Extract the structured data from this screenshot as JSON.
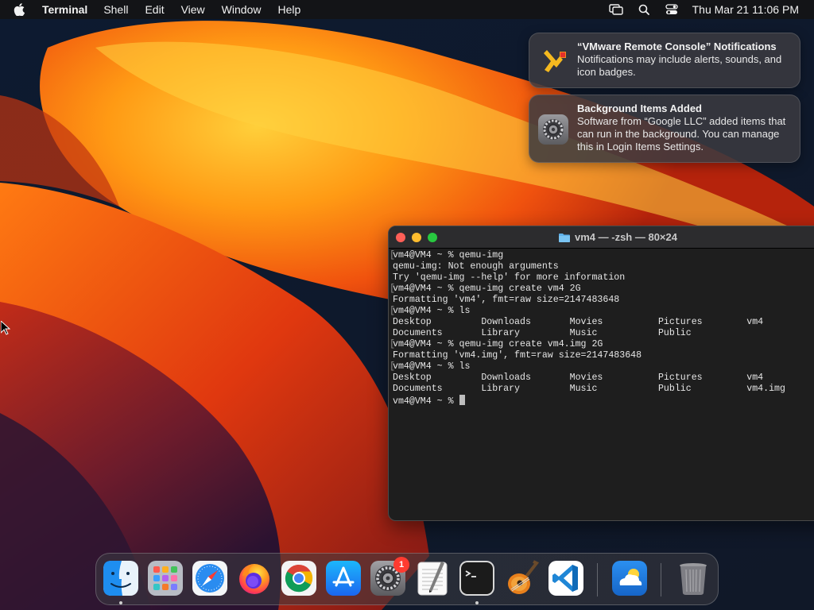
{
  "menubar": {
    "app_name": "Terminal",
    "menus": [
      "Shell",
      "Edit",
      "View",
      "Window",
      "Help"
    ],
    "clock": "Thu Mar 21  11:06 PM"
  },
  "notifications": [
    {
      "title": "“VMware Remote Console” Notifications",
      "body": "Notifications may include alerts, sounds, and icon badges.",
      "icon": "vmware-remote-console-icon"
    },
    {
      "title": "Background Items Added",
      "body": "Software from “Google LLC” added items that can run in the background. You can manage this in Login Items Settings.",
      "icon": "system-settings-gear-icon"
    }
  ],
  "terminal": {
    "title": "vm4 — -zsh — 80×24",
    "lines": [
      {
        "text": "vm4@VM4 ~ % qemu-img",
        "mark": true
      },
      {
        "text": "qemu-img: Not enough arguments",
        "mark": false
      },
      {
        "text": "Try 'qemu-img --help' for more information",
        "mark": false
      },
      {
        "text": "vm4@VM4 ~ % qemu-img create vm4 2G",
        "mark": true
      },
      {
        "text": "Formatting 'vm4', fmt=raw size=2147483648",
        "mark": false
      },
      {
        "text": "vm4@VM4 ~ % ls",
        "mark": true
      },
      {
        "text": "Desktop         Downloads       Movies          Pictures        vm4",
        "mark": false
      },
      {
        "text": "Documents       Library         Music           Public",
        "mark": false
      },
      {
        "text": "vm4@VM4 ~ % qemu-img create vm4.img 2G",
        "mark": true
      },
      {
        "text": "Formatting 'vm4.img', fmt=raw size=2147483648",
        "mark": false
      },
      {
        "text": "vm4@VM4 ~ % ls",
        "mark": true
      },
      {
        "text": "Desktop         Downloads       Movies          Pictures        vm4",
        "mark": false
      },
      {
        "text": "Documents       Library         Music           Public          vm4.img",
        "mark": false
      }
    ],
    "prompt": "vm4@VM4 ~ % "
  },
  "dock": {
    "items": [
      {
        "name": "finder",
        "running": true
      },
      {
        "name": "launchpad",
        "running": false
      },
      {
        "name": "safari",
        "running": false
      },
      {
        "name": "firefox",
        "running": false
      },
      {
        "name": "chrome",
        "running": false
      },
      {
        "name": "app-store",
        "running": false
      },
      {
        "name": "system-settings",
        "running": false,
        "badge": "1"
      },
      {
        "name": "textedit",
        "running": false
      },
      {
        "name": "terminal",
        "running": true
      },
      {
        "name": "garageband",
        "running": false
      },
      {
        "name": "vscode",
        "running": false
      },
      {
        "name": "weather",
        "running": false
      },
      {
        "name": "trash",
        "running": false
      }
    ]
  },
  "colors": {
    "close": "#ff5f57",
    "minimize": "#febc2e",
    "maximize": "#28c840",
    "terminal_bg": "#1e1e1e",
    "badge": "#ff3b30"
  }
}
